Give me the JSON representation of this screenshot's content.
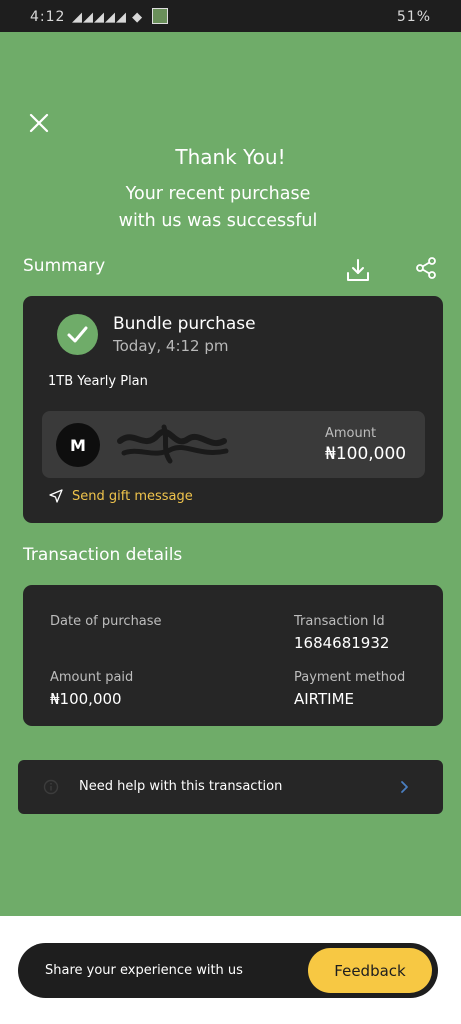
{
  "status_bar": {
    "time": "4:12",
    "notification_icons": "◢◢◢◢◢ ◆",
    "right_text": "51%"
  },
  "header": {
    "title": "Thank You!",
    "subtitle_line1": "Your recent purchase",
    "subtitle_line2": "with us was successful"
  },
  "summary": {
    "section_label": "Summary",
    "purchase_title": "Bundle purchase",
    "purchase_time": "Today, 4:12 pm",
    "plan_name": "1TB Yearly Plan",
    "recipient_initial": "M",
    "amount_label": "Amount",
    "amount_value": "₦100,000",
    "gift_message_label": "Send gift message"
  },
  "transaction": {
    "section_label": "Transaction details",
    "date_label": "Date of purchase",
    "date_value": "",
    "id_label": "Transaction Id",
    "id_value": "1684681932",
    "amount_paid_label": "Amount paid",
    "amount_paid_value": "₦100,000",
    "payment_method_label": "Payment method",
    "payment_method_value": "AIRTIME"
  },
  "help": {
    "label": "Need help with this transaction"
  },
  "feedback": {
    "prompt": "Share your experience with us",
    "button_label": "Feedback"
  },
  "colors": {
    "background_green": "#6fac69",
    "card_dark": "#262626",
    "accent_yellow": "#f7c843",
    "gift_text_yellow": "#f0c44c"
  },
  "icons": {
    "close": "close-icon",
    "download": "download-icon",
    "share": "share-icon",
    "check": "check-icon",
    "gift": "send-icon",
    "help": "info-icon",
    "chevron": "chevron-right-icon"
  }
}
